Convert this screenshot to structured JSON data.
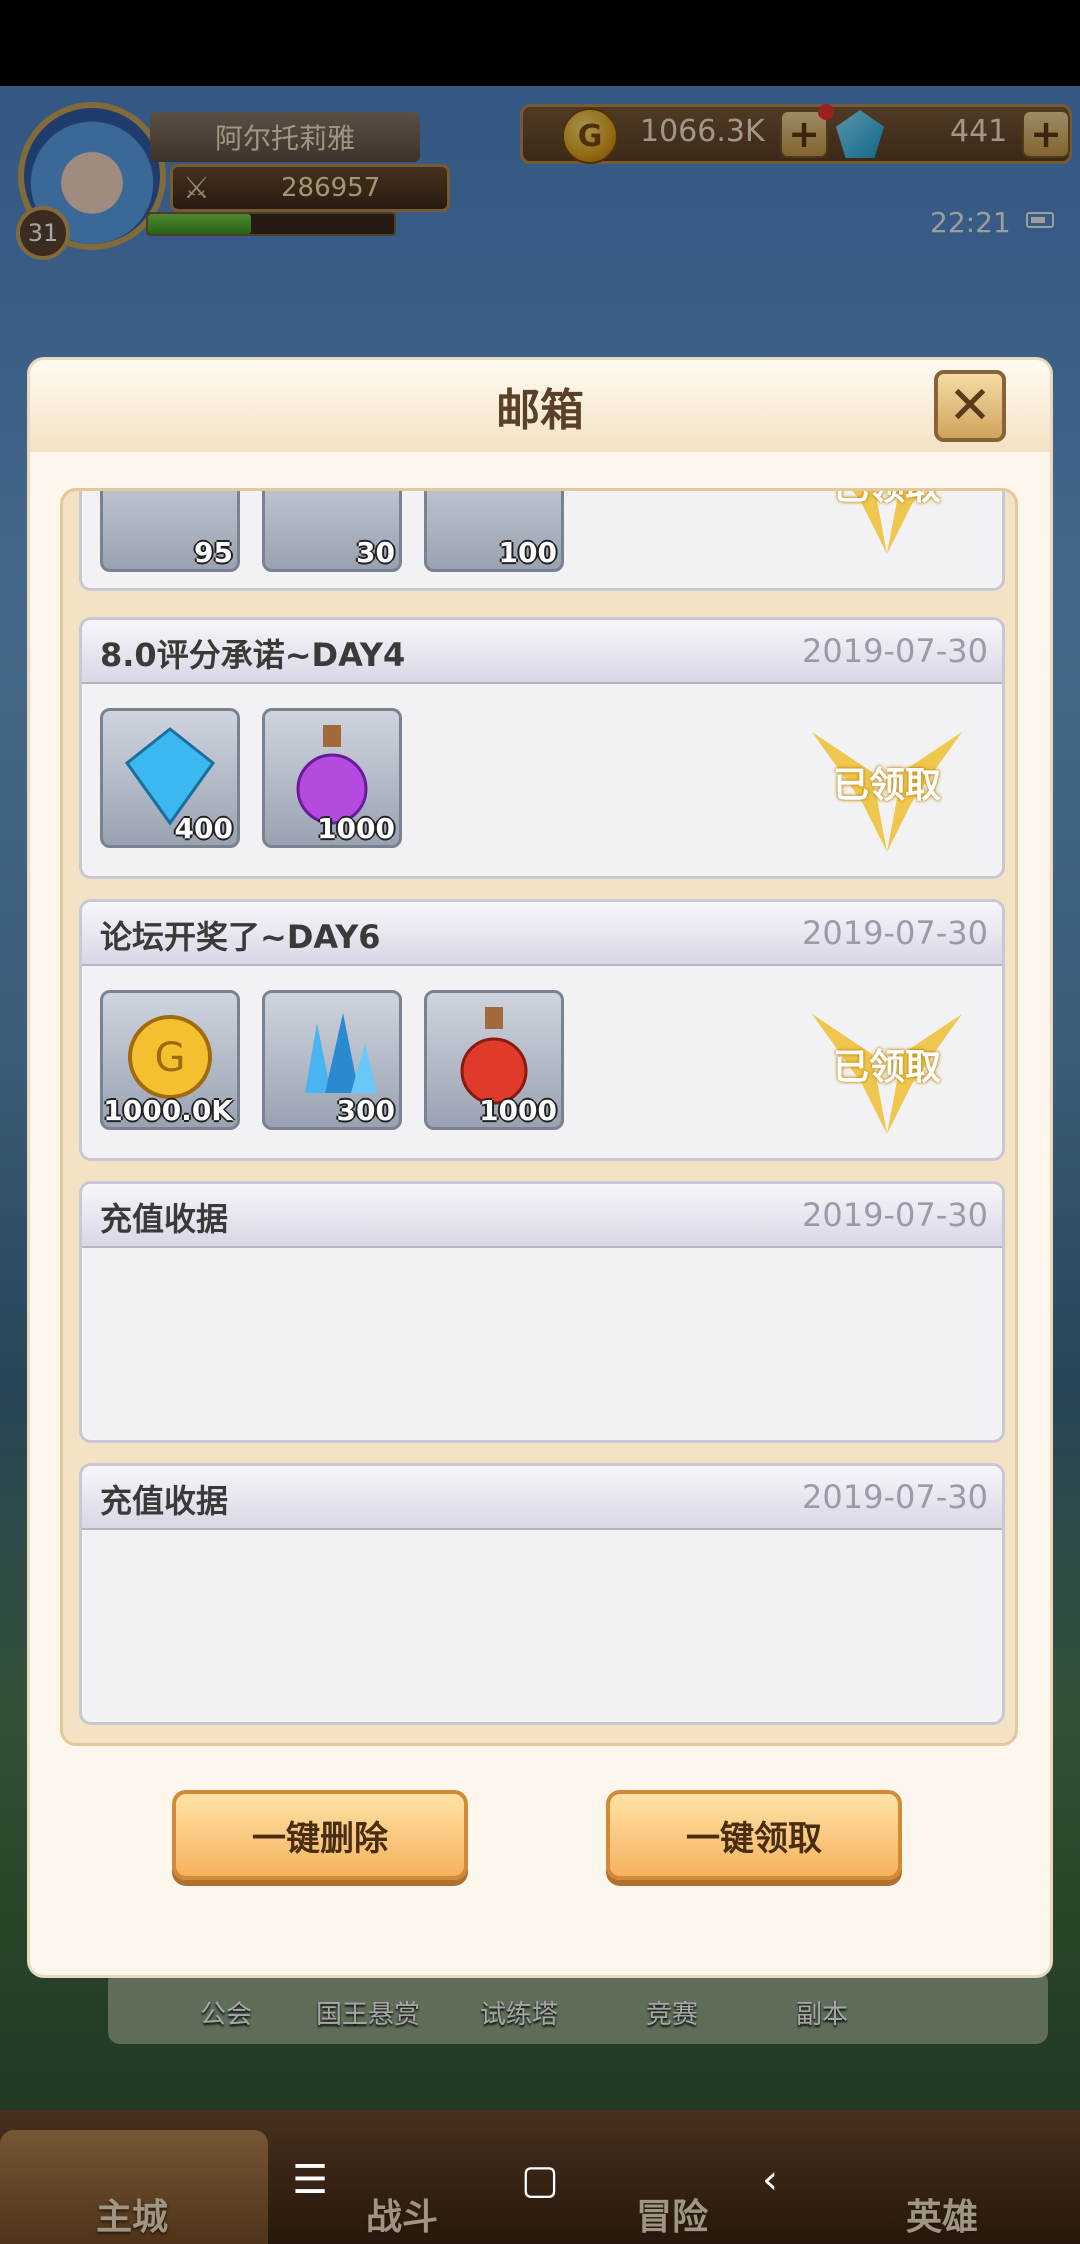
{
  "player": {
    "name": "阿尔托莉雅",
    "level": "31",
    "power": "286957",
    "exp_fraction": 0.42
  },
  "resources": {
    "gold": "1066.3K",
    "gems": "441"
  },
  "clock": "22:21",
  "modal": {
    "title": "邮箱",
    "mails": [
      {
        "title": "",
        "date": "",
        "items": [
          {
            "icon": "blue-gem-icon",
            "count": "95"
          },
          {
            "icon": "bronze-medal-icon",
            "count": "30"
          },
          {
            "icon": "ore-icon",
            "count": "100"
          }
        ],
        "status": "已领取"
      },
      {
        "title": "8.0评分承诺~DAY4",
        "date": "2019-07-30",
        "items": [
          {
            "icon": "diamond-icon",
            "count": "400"
          },
          {
            "icon": "purple-potion-icon",
            "count": "1000"
          }
        ],
        "status": "已领取"
      },
      {
        "title": "论坛开奖了~DAY6",
        "date": "2019-07-30",
        "items": [
          {
            "icon": "gold-coin-icon",
            "count": "1000.0K"
          },
          {
            "icon": "crystal-cluster-icon",
            "count": "300"
          },
          {
            "icon": "red-potion-icon",
            "count": "1000"
          }
        ],
        "status": "已领取"
      },
      {
        "title": "充值收据",
        "date": "2019-07-30",
        "items": [],
        "status": ""
      },
      {
        "title": "充值收据",
        "date": "2019-07-30",
        "items": [],
        "status": ""
      }
    ],
    "delete_all": "一键删除",
    "claim_all": "一键领取"
  },
  "features": [
    "公会",
    "国王悬赏",
    "试练塔",
    "竞赛",
    "副本"
  ],
  "nav": [
    "主城",
    "战斗",
    "冒险",
    "英雄"
  ],
  "colors": {
    "modal_bg": "#fcf6ec",
    "button_orange": "#f5b25e",
    "stamp_gold": "#f0c030"
  }
}
